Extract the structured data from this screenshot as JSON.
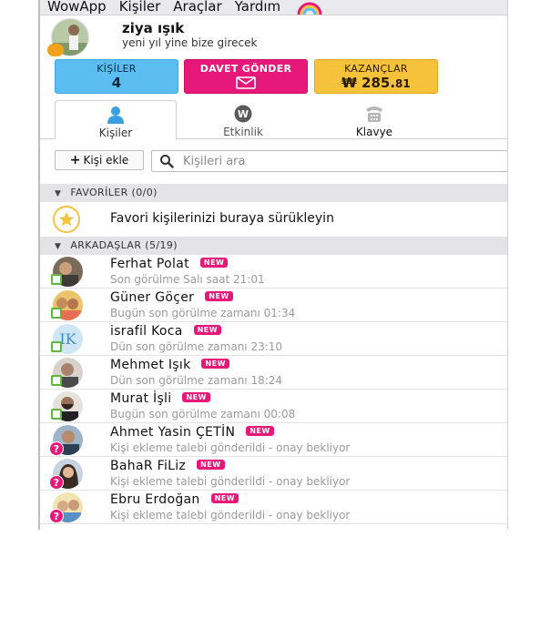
{
  "menu": [
    "WowApp",
    "Kişiler",
    "Araçlar",
    "Yardım"
  ],
  "profile": {
    "name": "ziya ışık",
    "status": "yeni yıl yine bize girecek"
  },
  "stats": {
    "contacts_label": "KİŞİLER",
    "contacts_value": "4",
    "invite_label": "DAVET GÖNDER",
    "earnings_label": "KAZANÇLAR",
    "earnings_currency": "₩",
    "earnings_main": "285.",
    "earnings_cents": "81"
  },
  "tabs": [
    "Kişiler",
    "Etkinlik",
    "Klavye"
  ],
  "toolbar": {
    "add_label": "Kişi ekle",
    "search_placeholder": "Kişileri ara"
  },
  "sections": {
    "favorites": "FAVORİLER (0/0)",
    "favorites_hint": "Favori kişilerinizi buraya sürükleyin",
    "friends": "ARKADAŞLAR (5/19)"
  },
  "new_label": "NEW",
  "contacts": [
    {
      "name": "Ferhat Polat",
      "status": "Son görülme Salı saat 21:01",
      "state": "online"
    },
    {
      "name": "Güner Göçer",
      "status": "Bugün son görülme zamanı 01:34",
      "state": "online"
    },
    {
      "name": "israfil  Koca",
      "status": "Dün son görülme zamanı 23:10",
      "state": "online",
      "initials": "IK"
    },
    {
      "name": "Mehmet Işık",
      "status": "Dün son görülme zamanı 18:24",
      "state": "online"
    },
    {
      "name": "Murat İşli",
      "status": "Bugün son görülme zamanı 00:08",
      "state": "online"
    },
    {
      "name": "Ahmet Yasin ÇETİN",
      "status": "Kişi ekleme talebi gönderildi - onay bekliyor",
      "state": "pending"
    },
    {
      "name": "BahaR  FiLiz",
      "status": "Kişi ekleme talebi gönderildi - onay bekliyor",
      "state": "pending"
    },
    {
      "name": "Ebru Erdoğan",
      "status": "Kişi ekleme talebi gönderildi - onay bekliyor",
      "state": "pending"
    }
  ],
  "colors": {
    "accent_blue": "#5bbdf0",
    "accent_pink": "#e8187a",
    "accent_gold": "#f6c23c",
    "online_green": "#62b53d"
  }
}
